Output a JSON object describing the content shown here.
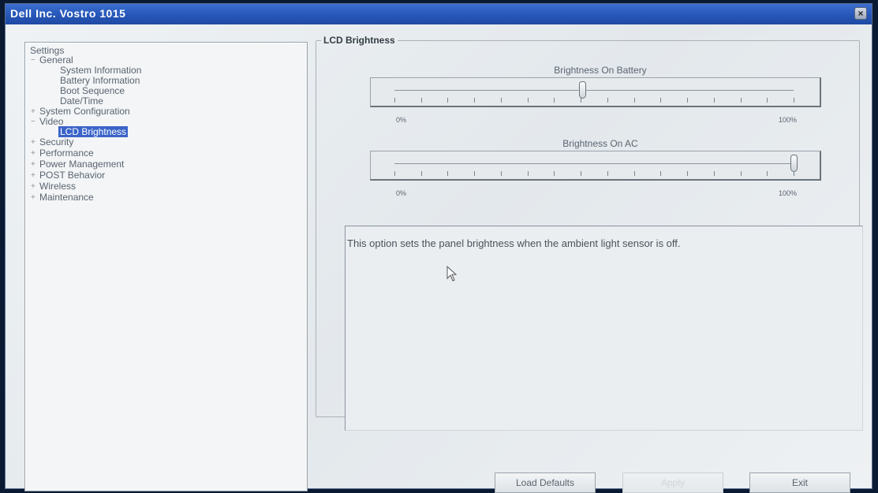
{
  "window": {
    "title": "Dell Inc. Vostro 1015",
    "close_glyph": "×"
  },
  "tree": {
    "root": "Settings",
    "items": [
      {
        "label": "General",
        "expander": "−"
      },
      {
        "label": "System Information"
      },
      {
        "label": "Battery Information"
      },
      {
        "label": "Boot Sequence"
      },
      {
        "label": "Date/Time"
      },
      {
        "label": "System Configuration",
        "expander": "+"
      },
      {
        "label": "Video",
        "expander": "−"
      },
      {
        "label": "LCD Brightness",
        "selected": true
      },
      {
        "label": "Security",
        "expander": "+"
      },
      {
        "label": "Performance",
        "expander": "+"
      },
      {
        "label": "Power Management",
        "expander": "+"
      },
      {
        "label": "POST Behavior",
        "expander": "+"
      },
      {
        "label": "Wireless",
        "expander": "+"
      },
      {
        "label": "Maintenance",
        "expander": "+"
      }
    ]
  },
  "group": {
    "label": "LCD Brightness"
  },
  "sliders": {
    "battery": {
      "title": "Brightness On Battery",
      "min_label": "0%",
      "max_label": "100%",
      "value_fraction": 0.47
    },
    "ac": {
      "title": "Brightness On AC",
      "min_label": "0%",
      "max_label": "100%",
      "value_fraction": 1.0
    }
  },
  "description": "This option sets the panel brightness when the ambient light sensor is off.",
  "buttons": {
    "load_defaults": "Load Defaults",
    "apply": "Apply",
    "exit": "Exit"
  },
  "icons": {
    "cursor": "arrow-cursor-icon"
  }
}
